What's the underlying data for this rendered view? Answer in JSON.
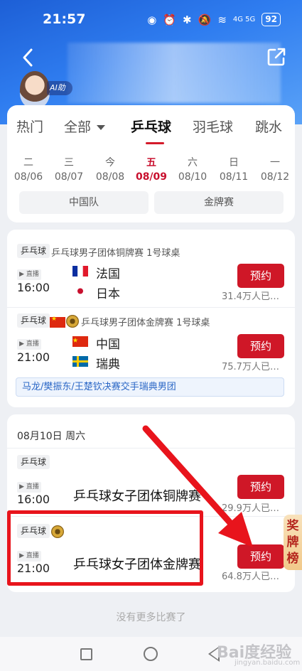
{
  "status_bar": {
    "time": "21:57",
    "network": "4G 5G",
    "battery": "92"
  },
  "header": {
    "ai_label": "AI助"
  },
  "sport_tabs": [
    {
      "label": "热门"
    },
    {
      "label": "全部"
    },
    {
      "label": "乒乓球",
      "active": true
    },
    {
      "label": "羽毛球"
    },
    {
      "label": "跳水"
    }
  ],
  "days": [
    {
      "weekday": "二",
      "date": "08/06"
    },
    {
      "weekday": "三",
      "date": "08/07"
    },
    {
      "weekday": "今",
      "date": "08/08"
    },
    {
      "weekday": "五",
      "date": "08/09",
      "active": true
    },
    {
      "weekday": "六",
      "date": "08/10"
    },
    {
      "weekday": "日",
      "date": "08/11"
    },
    {
      "weekday": "一",
      "date": "08/12"
    }
  ],
  "filters": [
    "中国队",
    "金牌赛"
  ],
  "live_label": "▶ 直播",
  "reserve_label": "预约",
  "sport_tag": "乒乓球",
  "matches_day1": [
    {
      "title": "乒乓球男子团体铜牌赛 1号球桌",
      "time": "16:00",
      "team1": "法国",
      "team2": "日本",
      "count": "31.4万人已…"
    },
    {
      "title": "乒乓球男子团体金牌赛 1号球桌",
      "time": "21:00",
      "team1": "中国",
      "team2": "瑞典",
      "count": "75.7万人已…",
      "players": "马龙/樊振东/王楚钦决赛交手瑞典男团"
    }
  ],
  "date_header": "08月10日 周六",
  "matches_day2": [
    {
      "title": "乒乓球女子团体铜牌赛",
      "time": "16:00",
      "count": "29.9万人已…"
    },
    {
      "title": "乒乓球女子团体金牌赛",
      "time": "21:00",
      "count": "64.8万人已…"
    }
  ],
  "side_badge": "奖牌榜",
  "footer": {
    "no_more": "没有更多比赛了"
  },
  "watermark": {
    "brand": "Bai度经验",
    "url": "jingyan.baidu.com"
  },
  "colors": {
    "accent": "#cf1727",
    "hero_blue": "#2f7df0",
    "highlight_red": "#e8141c"
  }
}
